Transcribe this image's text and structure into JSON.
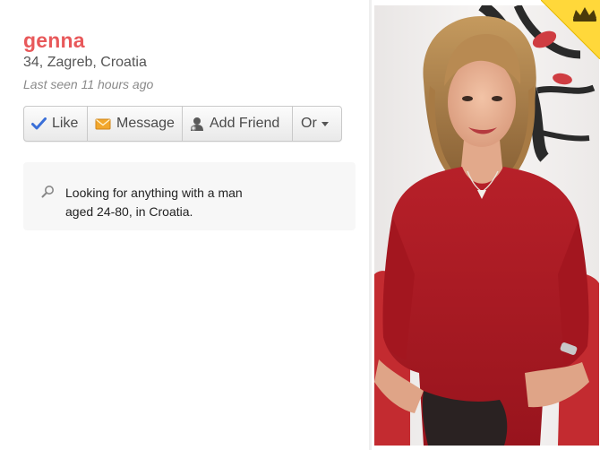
{
  "profile": {
    "name": "genna",
    "info": "34, Zagreb, Croatia",
    "last_seen": "Last seen 11 hours ago"
  },
  "actions": {
    "like_label": "Like",
    "message_label": "Message",
    "add_friend_label": "Add Friend",
    "or_label": "Or"
  },
  "looking_for": {
    "line1": "Looking for anything with a man",
    "line2": "aged 24-80, in Croatia."
  },
  "icons": {
    "like": "checkmark-icon",
    "message": "envelope-icon",
    "add_friend": "person-icon",
    "or": "caret-down-icon",
    "looking_for": "search-icon",
    "badge": "crown-icon"
  },
  "colors": {
    "name": "#e8585a",
    "like_check": "#3a6fd8",
    "message_envelope": "#f2a72c",
    "dress": "#b01e26",
    "badge_bg": "#ffd83a",
    "crown": "#4a3a0a"
  }
}
